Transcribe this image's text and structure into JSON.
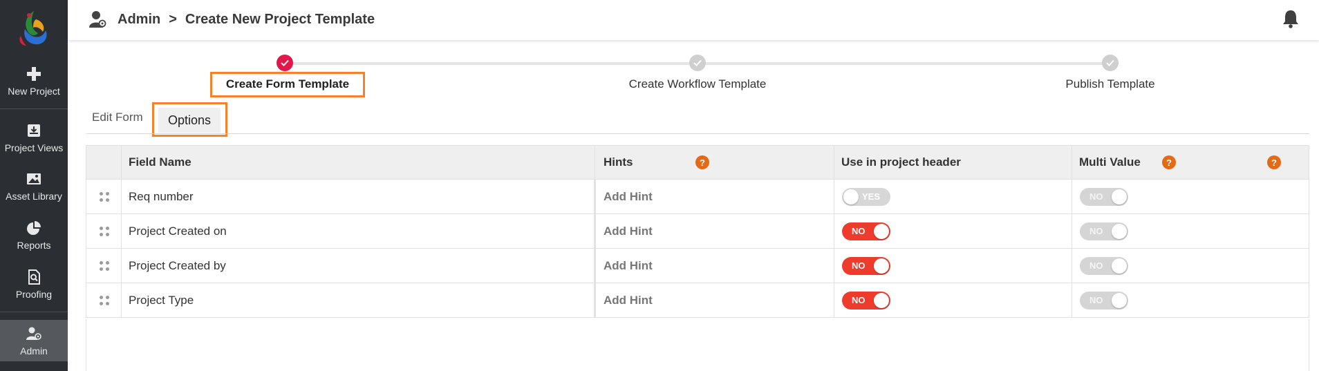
{
  "sidebar": {
    "items": [
      {
        "label": "New Project",
        "icon": "plus-icon"
      },
      {
        "label": "Project Views",
        "icon": "inbox-icon"
      },
      {
        "label": "Asset Library",
        "icon": "image-icon"
      },
      {
        "label": "Reports",
        "icon": "pie-chart-icon"
      },
      {
        "label": "Proofing",
        "icon": "proof-search-icon"
      },
      {
        "label": "Admin",
        "icon": "admin-user-icon"
      }
    ]
  },
  "header": {
    "crumb_root": "Admin",
    "crumb_sep": ">",
    "crumb_page": "Create New Project Template"
  },
  "stepper": {
    "steps": [
      {
        "label": "Create Form Template",
        "state": "done"
      },
      {
        "label": "Create Workflow Template",
        "state": "pending"
      },
      {
        "label": "Publish Template",
        "state": "pending"
      }
    ]
  },
  "tabs": {
    "edit_form": "Edit Form",
    "options": "Options"
  },
  "table": {
    "columns": {
      "field_name": "Field Name",
      "hints": "Hints",
      "header": "Use in project header",
      "multi": "Multi Value"
    },
    "help_glyph": "?",
    "rows": [
      {
        "field": "Req number",
        "hint": "Add Hint",
        "header_toggle": "YES",
        "multi_toggle": "NO"
      },
      {
        "field": "Project Created on",
        "hint": "Add Hint",
        "header_toggle": "NO",
        "multi_toggle": "NO"
      },
      {
        "field": "Project Created by",
        "hint": "Add Hint",
        "header_toggle": "NO",
        "multi_toggle": "NO"
      },
      {
        "field": "Project Type",
        "hint": "Add Hint",
        "header_toggle": "NO",
        "multi_toggle": "NO"
      }
    ]
  },
  "colors": {
    "sidebar_bg": "#2b2f33",
    "accent_highlight": "#f5822a",
    "step_done": "#e0194a",
    "toggle_on": "#ee3b2c",
    "help_icon": "#e46a16"
  }
}
